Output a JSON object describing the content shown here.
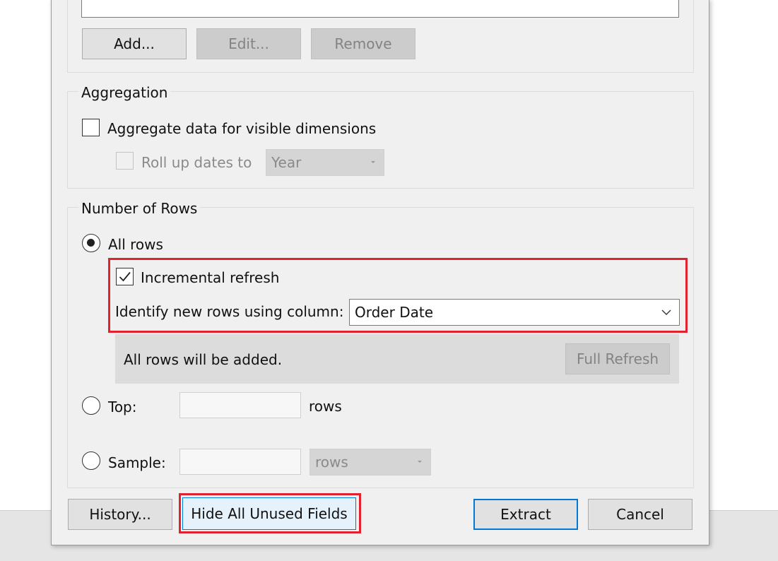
{
  "filters": {
    "add_label": "Add...",
    "edit_label": "Edit...",
    "remove_label": "Remove"
  },
  "aggregation": {
    "title": "Aggregation",
    "aggregate_label": "Aggregate data for visible dimensions",
    "aggregate_checked": false,
    "rollup_label": "Roll up dates to",
    "rollup_value": "Year"
  },
  "rows": {
    "title": "Number of Rows",
    "all_rows_label": "All rows",
    "incremental_label": "Incremental refresh",
    "incremental_checked": true,
    "identify_label": "Identify new rows using column:",
    "identify_value": "Order Date",
    "info_text": "All rows will be added.",
    "full_refresh_label": "Full Refresh",
    "top_label": "Top:",
    "top_value": "",
    "top_unit": "rows",
    "sample_label": "Sample:",
    "sample_value": "",
    "sample_unit": "rows"
  },
  "footer": {
    "history_label": "History...",
    "hide_unused_label": "Hide All Unused Fields",
    "extract_label": "Extract",
    "cancel_label": "Cancel"
  },
  "colors": {
    "highlight": "#e0212e",
    "accent": "#0078d7",
    "dialog_bg": "#f0f0f0"
  }
}
